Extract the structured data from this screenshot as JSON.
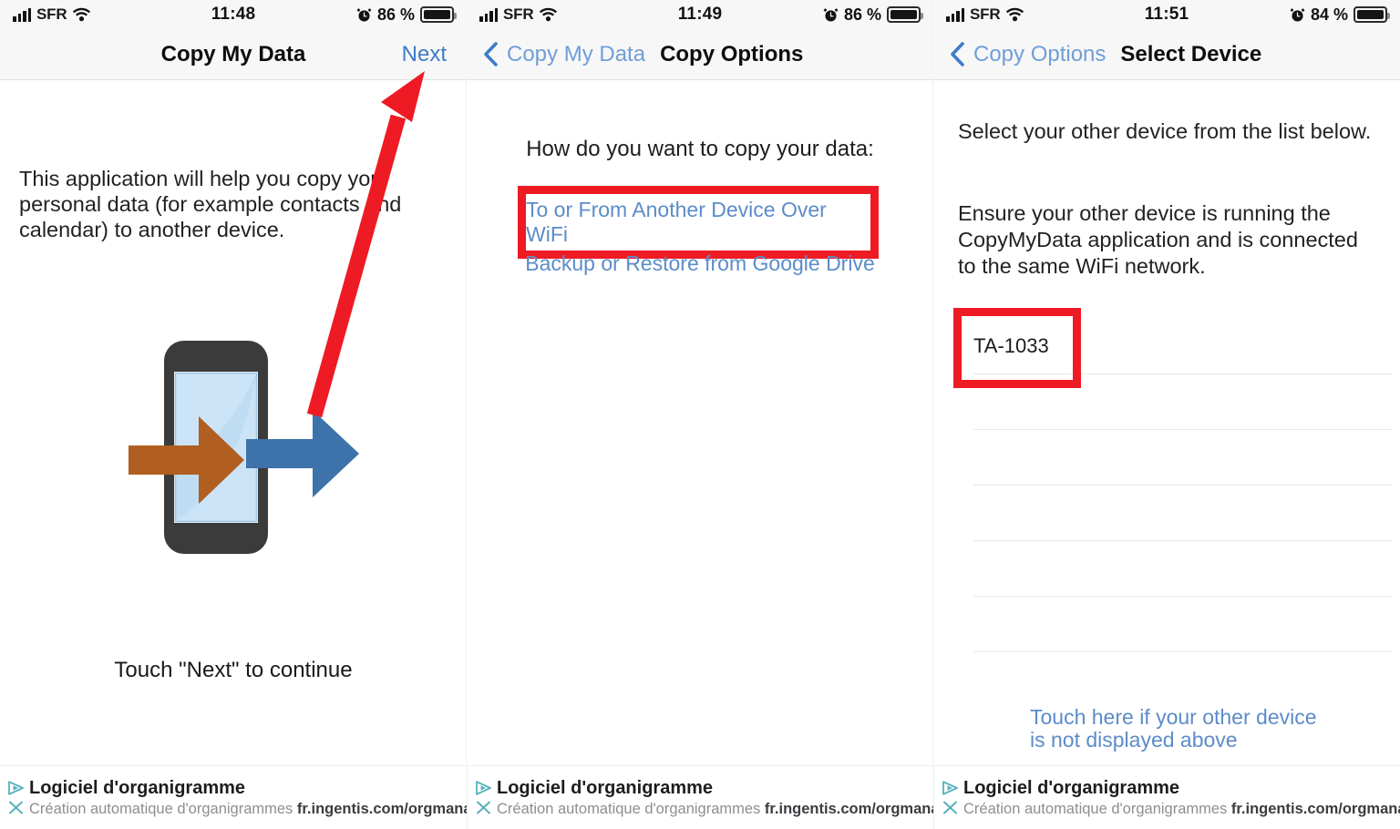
{
  "colors": {
    "link_blue": "#5c8cc9",
    "nav_blue": "#3d7cc9",
    "nav_back_blue": "#6f9ed8",
    "annotation_red": "#ee1b24",
    "illustration_orange": "#b05f21",
    "illustration_blue": "#3d72ab",
    "phone_body": "#3b3b3b",
    "phone_screen": "#bfdcf2",
    "ad_accent": "#57b0bd",
    "separator": "#e8e8e8"
  },
  "panels": [
    {
      "status_bar": {
        "signal_icon": "signal-bars-icon",
        "carrier": "SFR",
        "wifi_icon": "wifi-icon",
        "time": "11:48",
        "alarm_icon": "alarm-clock-icon",
        "battery_percent": "86 %",
        "battery_icon": "battery-icon"
      },
      "nav": {
        "type": "title-only",
        "title": "Copy My Data",
        "right_button": "Next"
      },
      "body": {
        "intro": "This application will help you copy your personal data (for example contacts and calendar) to another device.",
        "illustration": "phone-transfer-arrows-illustration",
        "footer": "Touch \"Next\" to continue",
        "annotation": "red-arrow-pointing-to-next-button"
      }
    },
    {
      "status_bar": {
        "signal_icon": "signal-bars-icon",
        "carrier": "SFR",
        "wifi_icon": "wifi-icon",
        "time": "11:49",
        "alarm_icon": "alarm-clock-icon",
        "battery_percent": "86 %",
        "battery_icon": "battery-icon"
      },
      "nav": {
        "type": "back-and-title",
        "back_label": "Copy My Data",
        "back_icon": "chevron-left-icon",
        "title": "Copy Options"
      },
      "body": {
        "question": "How do you want to copy your data:",
        "option_primary": "To or From Another Device Over WiFi",
        "option_secondary": "Backup or Restore from Google Drive",
        "annotation": "red-box-around-wifi-option"
      }
    },
    {
      "status_bar": {
        "signal_icon": "signal-bars-icon",
        "carrier": "SFR",
        "wifi_icon": "wifi-icon",
        "time": "11:51",
        "alarm_icon": "alarm-clock-icon",
        "battery_percent": "84 %",
        "battery_icon": "battery-icon"
      },
      "nav": {
        "type": "back-and-title",
        "back_label": "Copy Options",
        "back_icon": "chevron-left-icon",
        "title": "Select Device"
      },
      "body": {
        "line1": "Select your other device from the list below.",
        "line2": "Ensure your other device is running the CopyMyData application and is connected to the same WiFi network.",
        "device_list": [
          {
            "name": "TA-1033"
          },
          {
            "name": ""
          },
          {
            "name": ""
          },
          {
            "name": ""
          },
          {
            "name": ""
          },
          {
            "name": ""
          }
        ],
        "bottom_link_line1": "Touch here if your other device",
        "bottom_link_line2": "is not displayed above",
        "annotation": "red-box-around-device-ta-1033"
      }
    }
  ],
  "ads": [
    {
      "adchoices_icon": "adchoices-triangle-icon",
      "close_icon": "close-x-icon",
      "title": "Logiciel d'organigramme",
      "subtitle": "Création automatique d'organigrammes",
      "url": "fr.ingentis.com/orgmanager"
    },
    {
      "adchoices_icon": "adchoices-triangle-icon",
      "close_icon": "close-x-icon",
      "title": "Logiciel d'organigramme",
      "subtitle": "Création automatique d'organigrammes",
      "url": "fr.ingentis.com/orgmanager"
    },
    {
      "adchoices_icon": "adchoices-triangle-icon",
      "close_icon": "close-x-icon",
      "title": "Logiciel d'organigramme",
      "subtitle": "Création automatique d'organigrammes",
      "url": "fr.ingentis.com/orgmanager"
    }
  ]
}
